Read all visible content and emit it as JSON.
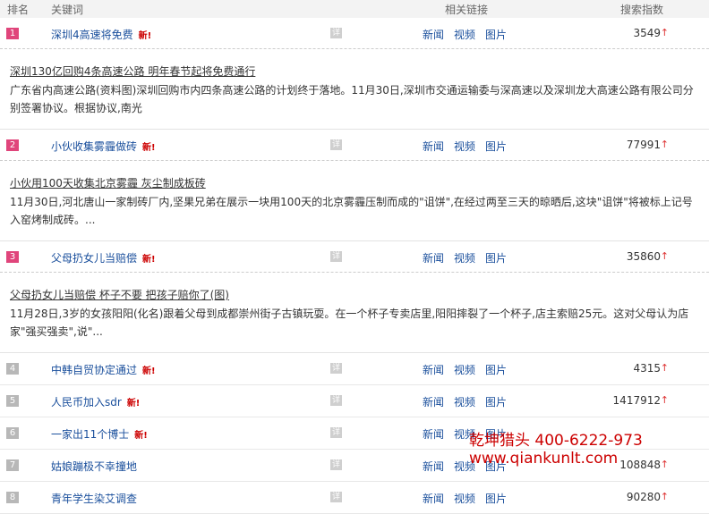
{
  "header": {
    "rank": "排名",
    "keyword": "关键词",
    "links": "相关链接",
    "index": "搜索指数"
  },
  "labels": {
    "new": "新!",
    "detail": "详",
    "news": "新闻",
    "video": "视频",
    "image": "图片"
  },
  "rows": [
    {
      "rank": "1",
      "keyword": "深圳4高速将免费",
      "new": true,
      "index": "3549",
      "detail_title": "深圳130亿回购4条高速公路 明年春节起将免费通行",
      "detail_desc": "广东省内高速公路(资料图)深圳回购市内四条高速公路的计划终于落地。11月30日,深圳市交通运输委与深高速以及深圳龙大高速公路有限公司分别签署协议。根据协议,南光"
    },
    {
      "rank": "2",
      "keyword": "小伙收集雾霾做砖",
      "new": true,
      "index": "77991",
      "detail_title": "小伙用100天收集北京雾霾 灰尘制成板砖",
      "detail_desc": "11月30日,河北唐山一家制砖厂内,坚果兄弟在展示一块用100天的北京雾霾压制而成的\"诅饼\",在经过两至三天的晾晒后,这块\"诅饼\"将被标上记号入窑烤制成砖。..."
    },
    {
      "rank": "3",
      "keyword": "父母扔女儿当赔偿",
      "new": true,
      "index": "35860",
      "detail_title": "父母扔女儿当赔偿 杯子不要 把孩子赔你了(图)",
      "detail_desc": "11月28日,3岁的女孩阳阳(化名)跟着父母到成都崇州街子古镇玩耍。在一个杯子专卖店里,阳阳摔裂了一个杯子,店主索赔25元。这对父母认为店家\"强买强卖\",说\"..."
    },
    {
      "rank": "4",
      "keyword": "中韩自贸协定通过",
      "new": true,
      "index": "4315"
    },
    {
      "rank": "5",
      "keyword": "人民币加入sdr",
      "new": true,
      "index": "1417912"
    },
    {
      "rank": "6",
      "keyword": "一家出11个博士",
      "new": true,
      "index": ""
    },
    {
      "rank": "7",
      "keyword": "姑娘蹦极不幸撞地",
      "new": false,
      "index": "108848"
    },
    {
      "rank": "8",
      "keyword": "青年学生染艾调查",
      "new": false,
      "index": "90280"
    }
  ],
  "watermark": {
    "line1": "乾坤猎头  400-6222-973",
    "line2": "www.qiankunlt.com"
  }
}
